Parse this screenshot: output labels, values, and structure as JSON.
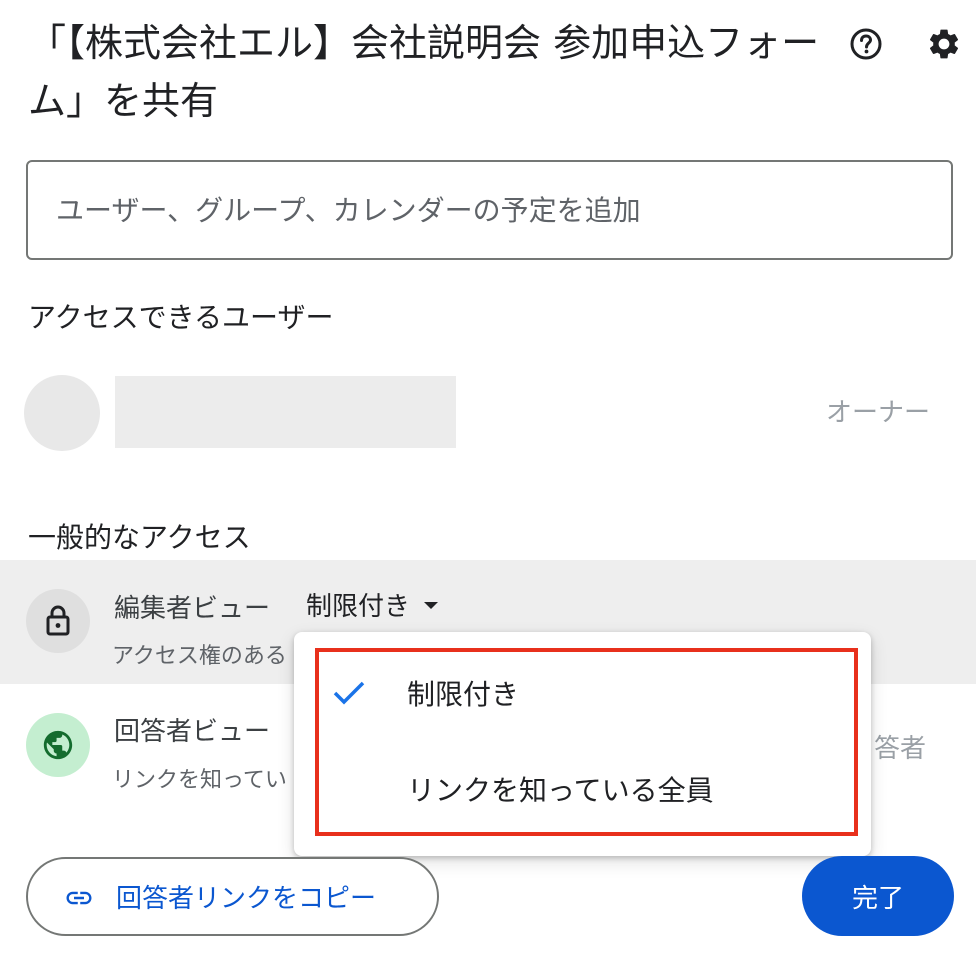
{
  "dialog": {
    "title": "「【株式会社エル】会社説明会 参加申込フォーム」を共有",
    "help_icon": "help-circle-icon",
    "settings_icon": "gear-icon"
  },
  "add_people": {
    "placeholder": "ユーザー、グループ、カレンダーの予定を追加"
  },
  "people_with_access": {
    "heading": "アクセスできるユーザー",
    "users": [
      {
        "role": "オーナー"
      }
    ]
  },
  "general_access": {
    "heading": "一般的なアクセス",
    "editor_view": {
      "label": "編集者ビュー",
      "access_value": "制限付き",
      "description": "アクセス権のある"
    },
    "responder_view": {
      "label": "回答者ビュー",
      "description": "リンクを知ってい",
      "role": "答者"
    }
  },
  "dropdown_menu": {
    "items": [
      {
        "label": "制限付き",
        "selected": true
      },
      {
        "label": "リンクを知っている全員",
        "selected": false
      }
    ]
  },
  "footer": {
    "copy_link_label": "回答者リンクをコピー",
    "done_label": "完了"
  },
  "colors": {
    "primary_blue": "#0b57d0",
    "highlight_red": "#e8301c",
    "globe_bg": "#c4eed0",
    "globe_fg": "#146c2e"
  }
}
